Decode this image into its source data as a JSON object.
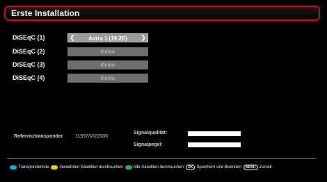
{
  "header": {
    "title": "Erste Installation",
    "border_color": "#c0102a"
  },
  "diseqc_rows": [
    {
      "label": "DiSEqC (1)",
      "value": "Astra 1 (19.2E)",
      "active": true
    },
    {
      "label": "DiSEqC (2)",
      "value": "Keine",
      "active": false
    },
    {
      "label": "DiSEqC (3)",
      "value": "Keine",
      "active": false
    },
    {
      "label": "DiSEqC (4)",
      "value": "Keine",
      "active": false
    }
  ],
  "transponder": {
    "label": "Referenztransponder",
    "value": "11597/V/22000"
  },
  "signal": {
    "quality_label": "Signalqualität:",
    "level_label": "Signalpegel:",
    "quality_fraction": 1.0,
    "level_fraction": 1.0
  },
  "footer": {
    "blue_color": "#2aa8e0",
    "yellow_color": "#f0d020",
    "green_color": "#2fb24a",
    "blue_text": "Transponderliste",
    "yellow_text": "Gewählten Satelliten durchsuchen",
    "green_text": "Alle Satelliten durchsuchen",
    "ok_key": "OK",
    "ok_text": "Speichern und Beenden",
    "menu_key": "MENU",
    "menu_text": "Zurück"
  }
}
